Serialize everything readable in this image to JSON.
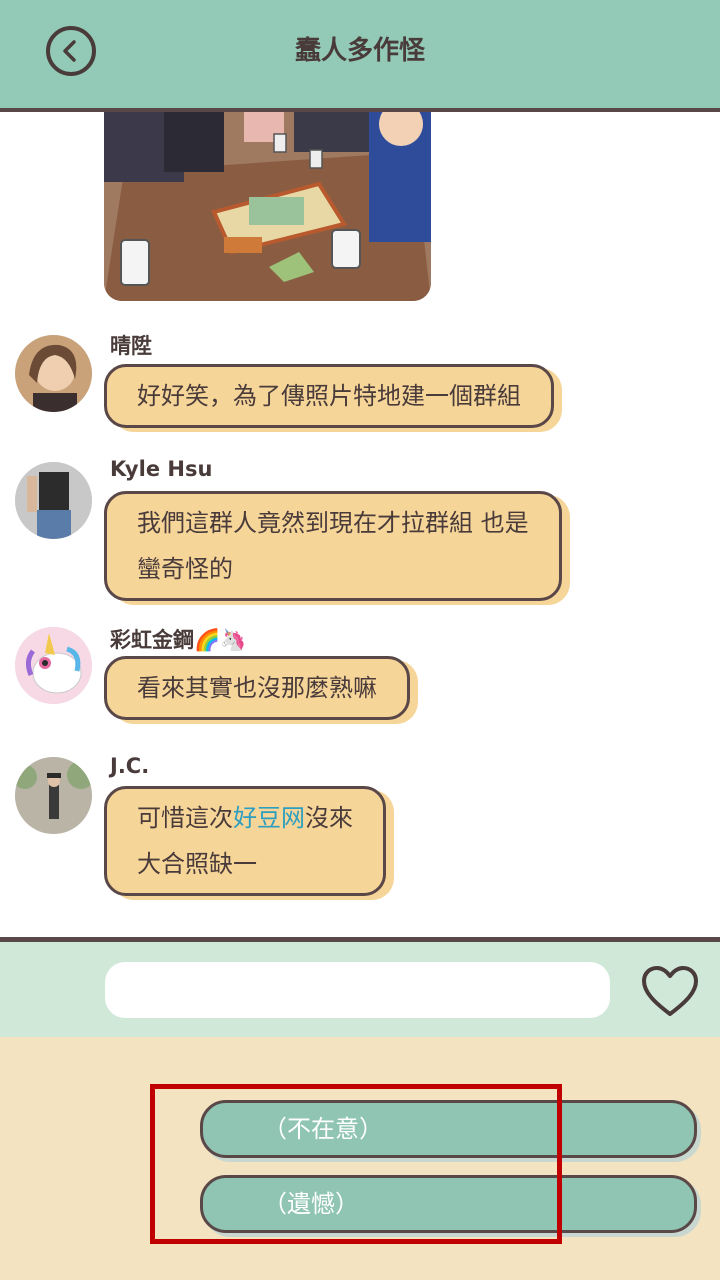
{
  "header": {
    "title": "蠢人多作怪"
  },
  "messages": [
    {
      "sender": "晴陞",
      "text": "好好笑，為了傳照片特地建一個群組"
    },
    {
      "sender": "Kyle Hsu",
      "text": "我們這群人竟然到現在才拉群組 也是\n蠻奇怪的"
    },
    {
      "sender": "彩虹金鋼🌈🦄",
      "text": "看來其實也沒那麼熟嘛"
    },
    {
      "sender": "J.C.",
      "text_before": "可惜這次",
      "text_highlight": "好豆网",
      "text_after": "沒來\n大合照缺一"
    }
  ],
  "input": {
    "value": ""
  },
  "choices": [
    "（不在意）",
    "（遺憾）"
  ],
  "colors": {
    "header_bg": "#93c9b7",
    "bubble_bg": "#f6d598",
    "choice_bg": "#8fc5b2",
    "input_bar_bg": "#cfe8d8",
    "choices_bg": "#f3e3c0",
    "highlight_link": "#2e9ec0",
    "annotation_box": "#c00000"
  },
  "icons": {
    "back": "back-arrow-icon",
    "like": "heart-icon"
  }
}
